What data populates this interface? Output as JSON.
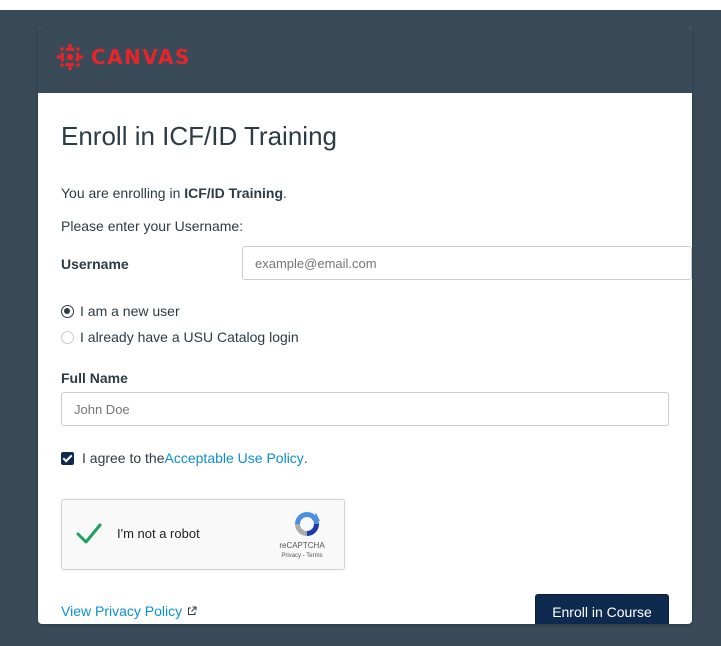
{
  "header": {
    "logo_text": "CANVAS",
    "logo_icon": "canvas-logo-icon",
    "brand_color": "#e72429",
    "background_color": "#394b58"
  },
  "page": {
    "title": "Enroll in ICF/ID Training"
  },
  "enrollment": {
    "intro_prefix": "You are enrolling in ",
    "course_name": "ICF/ID Training",
    "intro_suffix": ".",
    "prompt": "Please enter your Username:"
  },
  "username": {
    "label": "Username",
    "value": "",
    "placeholder": "example@email.com"
  },
  "user_type": {
    "options": [
      {
        "label": "I am a new user",
        "selected": true
      },
      {
        "label": "I already have a USU Catalog login",
        "selected": false
      }
    ]
  },
  "full_name": {
    "label": "Full Name",
    "value": "",
    "placeholder": "John Doe"
  },
  "agreement": {
    "checked": true,
    "prefix": "I agree to the ",
    "link_text": "Acceptable Use Policy",
    "suffix": "."
  },
  "recaptcha": {
    "label": "I'm not a robot",
    "brand": "reCAPTCHA",
    "terms": "Privacy - Terms",
    "checked": true,
    "check_color": "#1ba260"
  },
  "footer": {
    "privacy_link": "View Privacy Policy",
    "privacy_icon": "external-link-icon",
    "enroll_button": "Enroll in Course",
    "button_color": "#0e2a4e",
    "link_color": "#0b8ed3"
  }
}
